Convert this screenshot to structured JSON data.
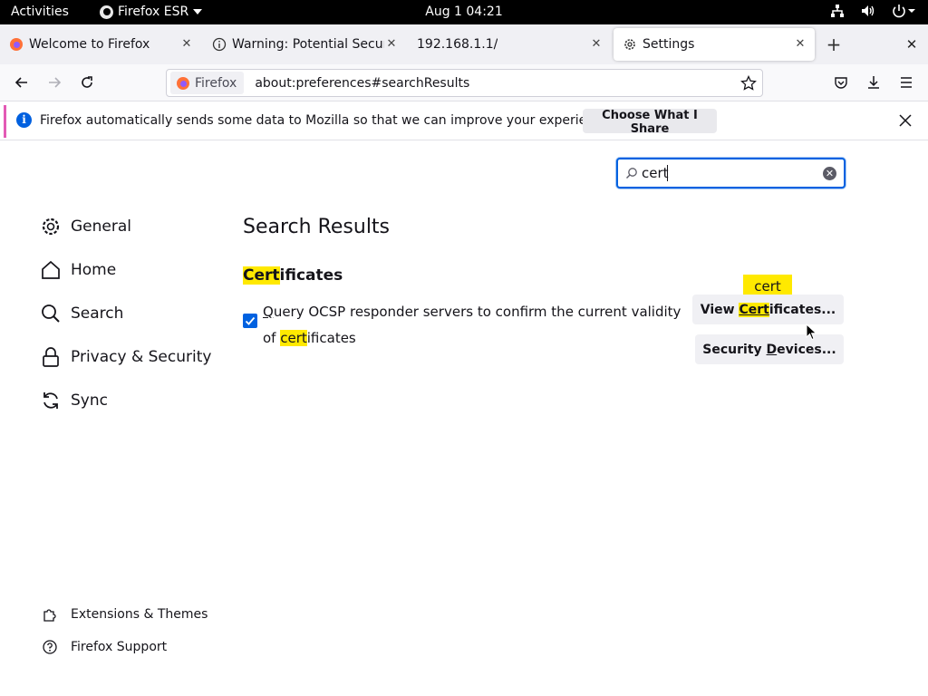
{
  "system": {
    "activities": "Activities",
    "app_name": "Firefox ESR",
    "clock": "Aug 1  04:21"
  },
  "tabs": [
    {
      "title": "Welcome to Firefox",
      "icon": "firefox-icon"
    },
    {
      "title": "Warning: Potential Securi",
      "icon": "info-icon"
    },
    {
      "title": "192.168.1.1/",
      "icon": "none"
    },
    {
      "title": "Settings",
      "icon": "gear-icon",
      "selected": true
    }
  ],
  "urlbar": {
    "identity_label": "Firefox",
    "url": "about:preferences#searchResults"
  },
  "notification": {
    "text": "Firefox automatically sends some data to Mozilla so that we can improve your experience.",
    "button": "Choose What I Share"
  },
  "search": {
    "value": "cert"
  },
  "sidebar": {
    "categories": [
      {
        "label": "General",
        "icon": "gear-icon"
      },
      {
        "label": "Home",
        "icon": "home-icon"
      },
      {
        "label": "Search",
        "icon": "search-icon"
      },
      {
        "label": "Privacy & Security",
        "icon": "lock-icon"
      },
      {
        "label": "Sync",
        "icon": "sync-icon"
      }
    ],
    "footer": [
      {
        "label": "Extensions & Themes",
        "icon": "puzzle-icon"
      },
      {
        "label": "Firefox Support",
        "icon": "help-icon"
      }
    ]
  },
  "main": {
    "results_title": "Search Results",
    "section_heading_hl": "Cert",
    "section_heading_rest": "ificates",
    "ocsp": {
      "checked": true,
      "access_key": "Q",
      "text_start": "uery OCSP responder servers to confirm the current validity of ",
      "text_hl": "cert",
      "text_end": "ificates"
    },
    "tooltip": "cert",
    "view_button": {
      "pre": "View ",
      "hl": "Cert",
      "post": "ificates..."
    },
    "devices_button": {
      "pre": "Security ",
      "access_key": "D",
      "post": "evices..."
    }
  },
  "colors": {
    "accent": "#0061e0",
    "highlight": "#ffe900",
    "notification_accent": "#e35ab5"
  }
}
